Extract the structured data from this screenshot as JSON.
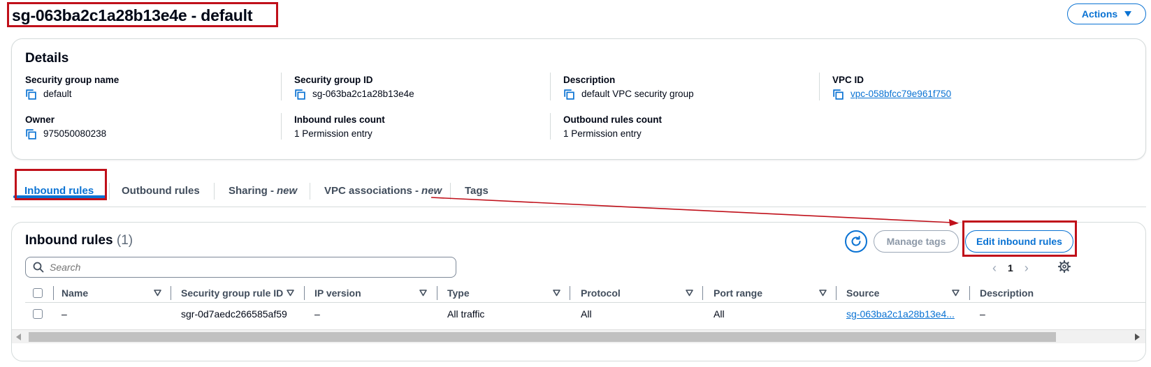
{
  "header": {
    "title": "sg-063ba2c1a28b13e4e - default",
    "actions_label": "Actions"
  },
  "details": {
    "title": "Details",
    "fields": {
      "sg_name": {
        "label": "Security group name",
        "value": "default"
      },
      "sg_id": {
        "label": "Security group ID",
        "value": "sg-063ba2c1a28b13e4e"
      },
      "description": {
        "label": "Description",
        "value": "default VPC security group"
      },
      "vpc_id": {
        "label": "VPC ID",
        "value": "vpc-058bfcc79e961f750"
      },
      "owner": {
        "label": "Owner",
        "value": "975050080238"
      },
      "inbound_count": {
        "label": "Inbound rules count",
        "value": "1 Permission entry"
      },
      "outbound_count": {
        "label": "Outbound rules count",
        "value": "1 Permission entry"
      }
    }
  },
  "tabs": [
    {
      "label": "Inbound rules",
      "suffix": "",
      "active": true
    },
    {
      "label": "Outbound rules",
      "suffix": "",
      "active": false
    },
    {
      "label": "Sharing -",
      "suffix": "new",
      "active": false
    },
    {
      "label": "VPC associations -",
      "suffix": "new",
      "active": false
    },
    {
      "label": "Tags",
      "suffix": "",
      "active": false
    }
  ],
  "inbound": {
    "title": "Inbound rules",
    "count": "(1)",
    "manage_tags_label": "Manage tags",
    "edit_label": "Edit inbound rules",
    "search_placeholder": "Search",
    "page": "1",
    "columns": [
      "Name",
      "Security group rule ID",
      "IP version",
      "Type",
      "Protocol",
      "Port range",
      "Source",
      "Description"
    ],
    "rows": [
      {
        "name": "–",
        "rule_id": "sgr-0d7aedc266585af59",
        "ip_version": "–",
        "type": "All traffic",
        "protocol": "All",
        "port_range": "All",
        "source": "sg-063ba2c1a28b13e4...",
        "description": "–"
      }
    ]
  },
  "colors": {
    "accent": "#0972d3",
    "annotation": "#c0101a",
    "border": "#d5dbdb",
    "text": "#000716"
  }
}
